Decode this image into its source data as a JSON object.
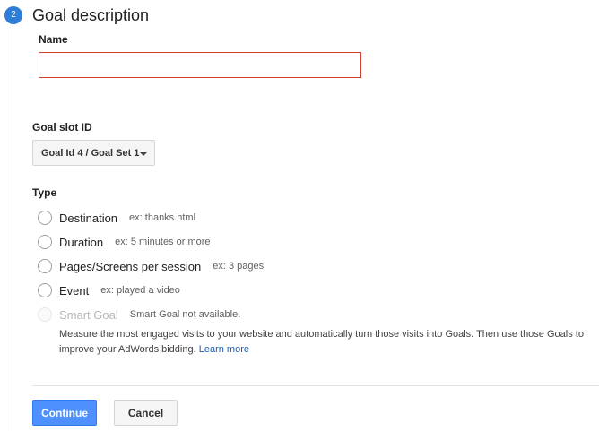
{
  "step": {
    "number": "2",
    "title": "Goal description"
  },
  "name_field": {
    "label": "Name",
    "value": "",
    "placeholder": ""
  },
  "goal_slot": {
    "label": "Goal slot ID",
    "selected": "Goal Id 4 / Goal Set 1"
  },
  "type": {
    "label": "Type",
    "options": [
      {
        "label": "Destination",
        "hint": "ex: thanks.html",
        "enabled": true
      },
      {
        "label": "Duration",
        "hint": "ex: 5 minutes or more",
        "enabled": true
      },
      {
        "label": "Pages/Screens per session",
        "hint": "ex: 3 pages",
        "enabled": true
      },
      {
        "label": "Event",
        "hint": "ex: played a video",
        "enabled": true
      },
      {
        "label": "Smart Goal",
        "hint": "Smart Goal not available.",
        "enabled": false
      }
    ],
    "smart_goal_description": "Measure the most engaged visits to your website and automatically turn those visits into Goals. Then use those Goals to improve your AdWords bidding.",
    "learn_more": "Learn more"
  },
  "buttons": {
    "continue": "Continue",
    "cancel": "Cancel"
  },
  "colors": {
    "accent": "#4d90fe",
    "step_badge": "#2e7ed7",
    "error_border": "#d23f31",
    "link": "#1a5fb4"
  }
}
